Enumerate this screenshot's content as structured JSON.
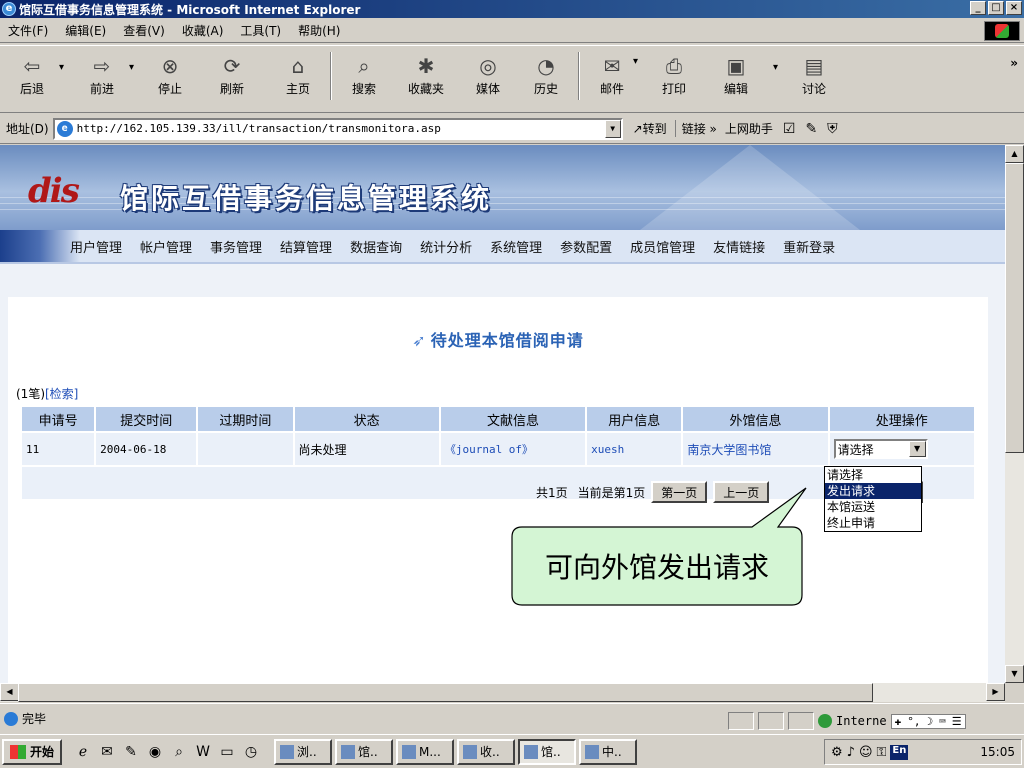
{
  "window": {
    "title": "馆际互借事务信息管理系统 - Microsoft Internet Explorer",
    "minimize": "_",
    "maximize": "□",
    "close": "×"
  },
  "menubar": [
    "文件(F)",
    "编辑(E)",
    "查看(V)",
    "收藏(A)",
    "工具(T)",
    "帮助(H)"
  ],
  "toolbar": {
    "back": "后退",
    "forward": "前进",
    "stop": "停止",
    "refresh": "刷新",
    "home": "主页",
    "search": "搜索",
    "favorites": "收藏夹",
    "media": "媒体",
    "history": "历史",
    "mail": "邮件",
    "print": "打印",
    "edit": "编辑",
    "discuss": "讨论",
    "more": "»"
  },
  "address": {
    "label": "地址(D)",
    "url": "http://162.105.139.33/ill/transaction/transmonitora.asp",
    "go": "转到",
    "links": "链接 »",
    "helper": "上网助手"
  },
  "banner": {
    "logo": "dis",
    "system_title": "馆际互借事务信息管理系统"
  },
  "nav": [
    "用户管理",
    "帐户管理",
    "事务管理",
    "结算管理",
    "数据查询",
    "统计分析",
    "系统管理",
    "参数配置",
    "成员馆管理",
    "友情链接",
    "重新登录"
  ],
  "page": {
    "heading": "待处理本馆借阅申请",
    "count_prefix": "(1笔)",
    "search_link": "[检索]"
  },
  "table": {
    "headers": [
      "申请号",
      "提交时间",
      "过期时间",
      "状态",
      "文献信息",
      "用户信息",
      "外馆信息",
      "处理操作"
    ],
    "rows": [
      {
        "id": "11",
        "submitted": "2004-06-18",
        "expires": "",
        "status": "尚未处理",
        "document": "《journal of》",
        "user": "xuesh",
        "library": "南京大学图书馆",
        "action": "请选择"
      }
    ]
  },
  "pager": {
    "summary": "共1页",
    "current": "当前是第1页",
    "first": "第一页",
    "prev": "上一页",
    "next_fragment": "一页"
  },
  "dropdown": {
    "options": [
      "请选择",
      "发出请求",
      "本馆运送",
      "终止申请"
    ],
    "highlighted": "发出请求"
  },
  "callout": {
    "text": "可向外馆发出请求"
  },
  "status": {
    "text": "完毕",
    "zone": "Interne"
  },
  "taskbar": {
    "start": "开始",
    "tasks": [
      "浏..",
      "馆..",
      "M...",
      "收..",
      "馆..",
      "中.."
    ],
    "clock": "15:05",
    "ime": "En"
  },
  "colors": {
    "title_bar": "#0a246a",
    "banner": "#6a8cbf",
    "nav": "#dbe5f4",
    "header_cell": "#b9cdea",
    "row_cell": "#eaf0f9",
    "callout_fill": "#d4f5d4",
    "link": "#1e4db7",
    "highlight": "#0a246a"
  }
}
